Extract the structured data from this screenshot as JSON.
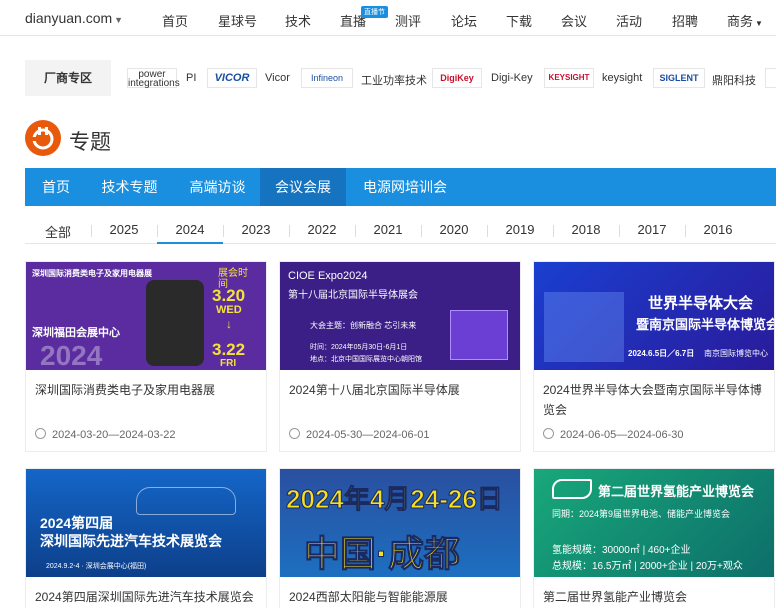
{
  "topnav": {
    "logo": "dianyuan.com",
    "items": [
      "首页",
      "星球号",
      "技术",
      "直播",
      "测评",
      "论坛",
      "下载",
      "会议",
      "活动",
      "招聘",
      "商务"
    ],
    "live_badge": "直播节"
  },
  "vendors": {
    "label": "厂商专区",
    "logos": [
      "power integrations",
      "VICOR",
      "Infineon",
      "DigiKey",
      "KEYSIGHT",
      "SIGLENT"
    ],
    "names": [
      "PI",
      "Vicor",
      "工业功率技术",
      "Digi-Key",
      "keysight",
      "鼎阳科技"
    ]
  },
  "header": {
    "title": "专题"
  },
  "tabs": [
    "首页",
    "技术专题",
    "高端访谈",
    "会议会展",
    "电源网培训会"
  ],
  "active_tab": "会议会展",
  "years": [
    "全部",
    "2025",
    "2024",
    "2023",
    "2022",
    "2021",
    "2020",
    "2019",
    "2018",
    "2017",
    "2016"
  ],
  "active_year": "2024",
  "cards": [
    {
      "title": "深圳国际消费类电子及家用电器展",
      "date": "2024-03-20—2024-03-22",
      "banner": {
        "line1": "深圳国际消费类电子及家用电器展",
        "line2": "深圳福田会展中心",
        "line3": "2024",
        "date_top": "3.20",
        "day_top": "WED",
        "date_bottom": "3.22",
        "day_bottom": "FRI",
        "tag": "展会时间"
      }
    },
    {
      "title": "2024第十八届北京国际半导体展",
      "date": "2024-05-30—2024-06-01",
      "banner": {
        "line1": "CIOE Expo2024",
        "line2": "第十八届北京国际半导体展会",
        "line3": "大会主题：创新融合 芯引未来",
        "line4": "时间：2024年05月30日-6月1日",
        "line5": "地点：北京中国国际展览中心朝阳馆"
      }
    },
    {
      "title": "2024世界半导体大会暨南京国际半导体博览会",
      "date": "2024-06-05—2024-06-30",
      "banner": {
        "line1": "世界半导体大会",
        "line2": "暨南京国际半导体博览会",
        "line3": "2024.6.5日／6.7日",
        "line4": "南京国际博览中心"
      }
    },
    {
      "title": "2024第四届深圳国际先进汽车技术展览会",
      "date": "",
      "banner": {
        "line1": "2024第四届",
        "line2": "深圳国际先进汽车技术展览会",
        "line3": "2024.9.2-4 · 深圳会展中心(福田)"
      }
    },
    {
      "title": "2024西部太阳能与智能能源展",
      "date": "",
      "banner": {
        "line1": "2024年4月24-26日",
        "line2": "中国·成都"
      }
    },
    {
      "title": "第二届世界氢能产业博览会",
      "date": "",
      "banner": {
        "line1": "第二届世界氢能产业博览会",
        "line2": "同期：2024第9届世界电池、储能产业博览会",
        "line3": "氢能规模：30000㎡ | 460+企业",
        "line4": "总规模：16.5万㎡ | 2000+企业 | 20万+观众"
      }
    }
  ],
  "colors": {
    "accent": "#1a8fe0",
    "accent_dark": "#1573bf",
    "brand_orange": "#e8590c"
  }
}
